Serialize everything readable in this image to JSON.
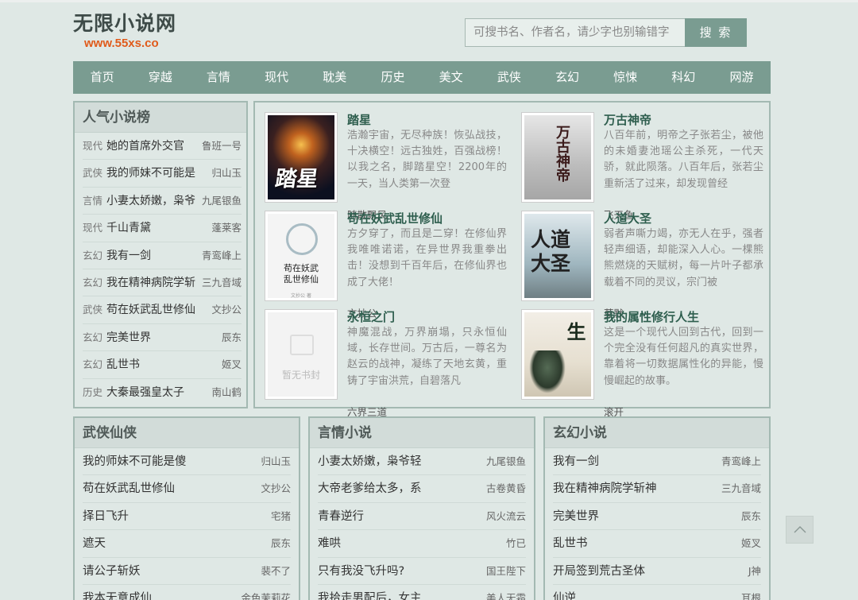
{
  "site": {
    "name": "无限小说网",
    "url": "www.55xs.co"
  },
  "search": {
    "placeholder": "可搜书名、作者名，请少字也别输错字",
    "button": "搜 索"
  },
  "nav": [
    "首页",
    "穿越",
    "言情",
    "现代",
    "耽美",
    "历史",
    "美文",
    "武侠",
    "玄幻",
    "惊悚",
    "科幻",
    "网游"
  ],
  "ranking": {
    "title": "人气小说榜",
    "items": [
      {
        "cat": "现代",
        "title": "她的首席外交官",
        "author": "鲁班一号"
      },
      {
        "cat": "武侠",
        "title": "我的师妹不可能是",
        "author": "归山玉"
      },
      {
        "cat": "言情",
        "title": "小妻太娇嫩，枭爷",
        "author": "九尾银鱼"
      },
      {
        "cat": "现代",
        "title": "千山青黛",
        "author": "蓬莱客"
      },
      {
        "cat": "玄幻",
        "title": "我有一剑",
        "author": "青鸾峰上"
      },
      {
        "cat": "玄幻",
        "title": "我在精神病院学斩",
        "author": "三九音域"
      },
      {
        "cat": "武侠",
        "title": "苟在妖武乱世修仙",
        "author": "文抄公"
      },
      {
        "cat": "玄幻",
        "title": "完美世界",
        "author": "辰东"
      },
      {
        "cat": "玄幻",
        "title": "乱世书",
        "author": "姬叉"
      },
      {
        "cat": "历史",
        "title": "大秦最强皇太子",
        "author": "南山鹤"
      }
    ]
  },
  "featured": [
    {
      "title": "踏星",
      "desc": "浩瀚宇宙，无尽种族！恢弘战技，十决横空！远古独姓，百强战榜！以我之名，脚踏星空！2200年的一天，当人类第一次登",
      "author": "随散飘风",
      "cover": {
        "style": "tx",
        "text": "踏星"
      }
    },
    {
      "title": "万古神帝",
      "desc": "八百年前，明帝之子张若尘，被他的未婚妻池瑶公主杀死，一代天骄，就此陨落。八百年后，张若尘重新活了过来，却发现曾经",
      "author": "飞天鱼",
      "cover": {
        "style": "gray",
        "text": "万古神帝"
      }
    },
    {
      "title": "苟在妖武乱世修仙",
      "desc": "方夕穿了，而且是二穿！在修仙界我唯唯诺诺，在异世界我重拳出击！没想到千百年后，在修仙界也成了大佬！",
      "author": "文抄公",
      "cover": {
        "style": "white",
        "text": "苟在妖武\n乱世修仙",
        "sub": "文抄公 著"
      }
    },
    {
      "title": "人道大圣",
      "desc": "弱者声嘶力竭，亦无人在乎，强者轻声细语，却能深入人心。一棵熊熊燃烧的天赋树，每一片叶子都承载着不同的灵议，宗门被",
      "author": "莫默",
      "cover": {
        "style": "sky",
        "text": "人道大圣"
      }
    },
    {
      "title": "永恒之门",
      "desc": "神魔混战，万界崩塌，只永恒仙域，长存世间。万古后，一尊名为赵云的战神，凝练了天地玄黄，重铸了宇宙洪荒，自碧落凡",
      "author": "六界三道",
      "cover": {
        "style": "empty",
        "text": "暂无书封"
      }
    },
    {
      "title": "我的属性修行人生",
      "desc": "这是一个现代人回到古代，回到一个完全没有任何超凡的真实世界，靠着将一切数据属性化的异能，慢慢崛起的故事。",
      "author": "滚开",
      "cover": {
        "style": "cream",
        "text": "修行人生"
      }
    }
  ],
  "sections": [
    {
      "title": "武侠仙侠",
      "items": [
        {
          "title": "我的师妹不可能是傻",
          "author": "归山玉"
        },
        {
          "title": "苟在妖武乱世修仙",
          "author": "文抄公"
        },
        {
          "title": "择日飞升",
          "author": "宅猪"
        },
        {
          "title": "遮天",
          "author": "辰东"
        },
        {
          "title": "请公子斩妖",
          "author": "裴不了"
        },
        {
          "title": "我本无意成仙",
          "author": "金色茉莉花"
        }
      ]
    },
    {
      "title": "言情小说",
      "items": [
        {
          "title": "小妻太娇嫩，枭爷轻",
          "author": "九尾银鱼"
        },
        {
          "title": "大帝老爹给太多，系",
          "author": "古卷黄昏"
        },
        {
          "title": "青春逆行",
          "author": "风火流云"
        },
        {
          "title": "难哄",
          "author": "竹已"
        },
        {
          "title": "只有我没飞升吗?",
          "author": "国王陛下"
        },
        {
          "title": "我拾走男配后，女主",
          "author": "美人无霜"
        }
      ]
    },
    {
      "title": "玄幻小说",
      "items": [
        {
          "title": "我有一剑",
          "author": "青鸾峰上"
        },
        {
          "title": "我在精神病院学斩神",
          "author": "三九音域"
        },
        {
          "title": "完美世界",
          "author": "辰东"
        },
        {
          "title": "乱世书",
          "author": "姬叉"
        },
        {
          "title": "开局签到荒古圣体",
          "author": "J神"
        },
        {
          "title": "仙逆",
          "author": "耳根"
        }
      ]
    }
  ]
}
